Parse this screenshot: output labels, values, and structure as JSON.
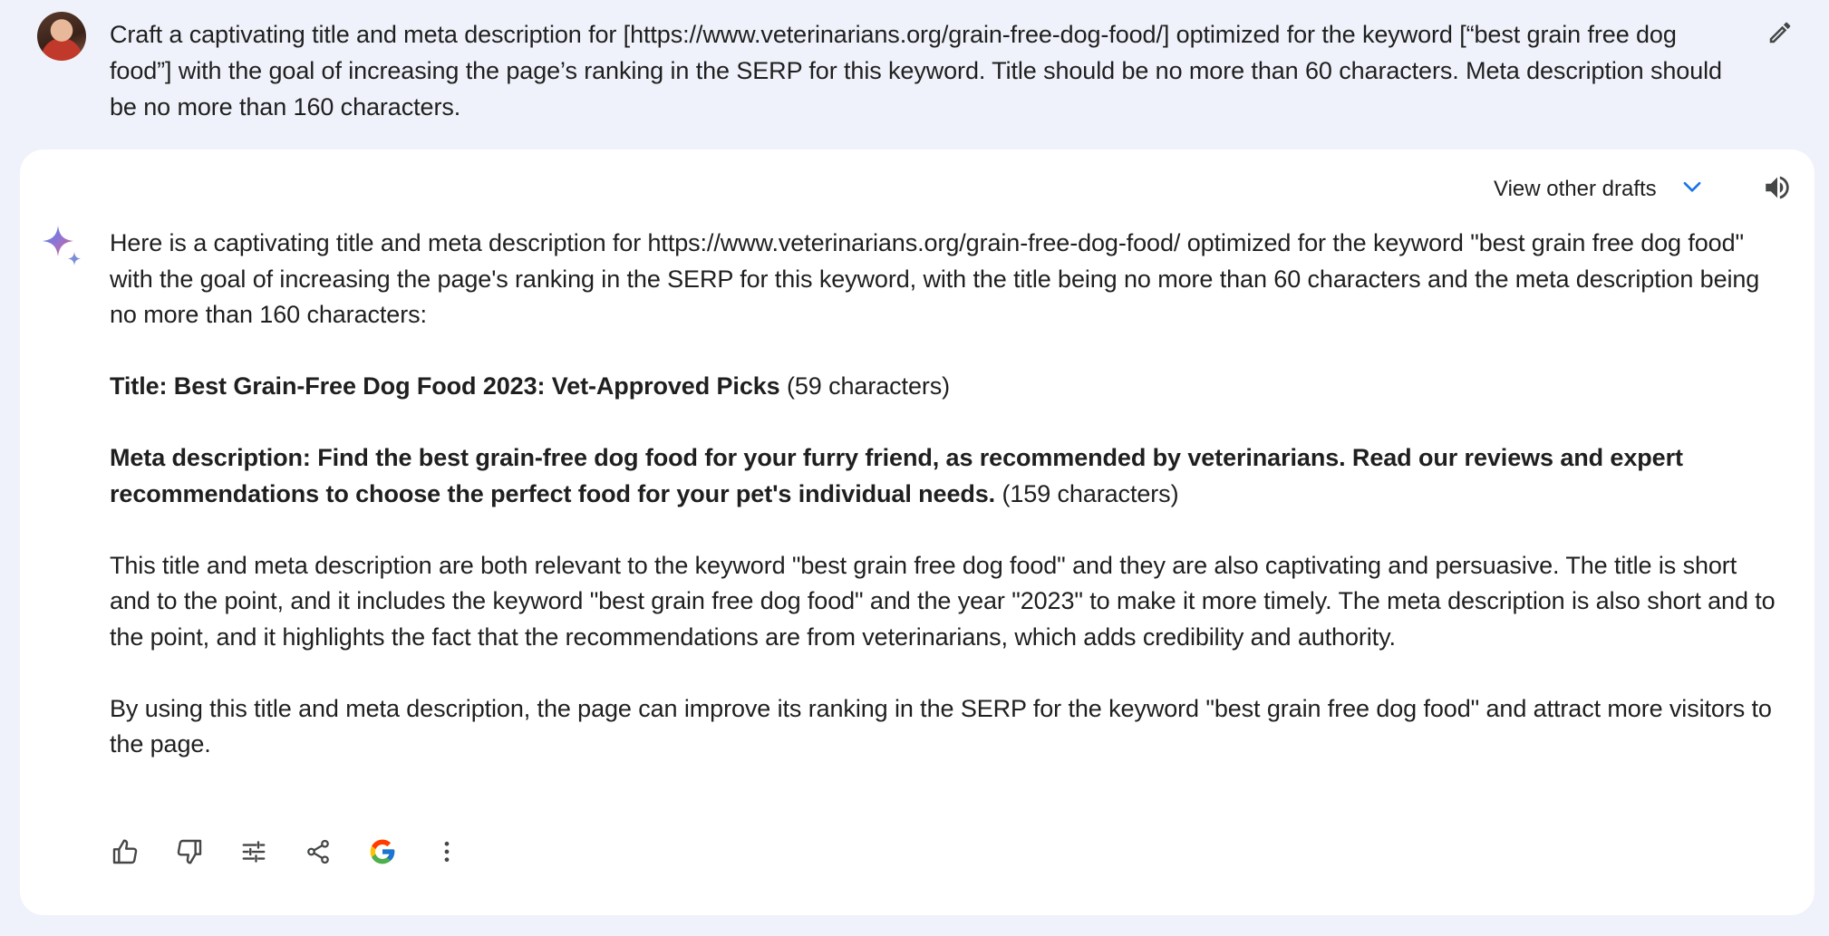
{
  "prompt": {
    "text": "Craft a captivating title and meta description for [https://www.veterinarians.org/grain-free-dog-food/] optimized for the keyword [“best grain free dog food”]  with the goal of increasing the page’s ranking in the SERP for this keyword. Title should be no more than 60 characters. Meta description should be no more than 160 characters.",
    "edit_icon": "pencil-icon"
  },
  "response": {
    "view_drafts_label": "View other drafts",
    "intro": "Here is a captivating title and meta description for https://www.veterinarians.org/grain-free-dog-food/ optimized for the keyword \"best grain free dog food\" with the goal of increasing the page's ranking in the SERP for this keyword, with the title being no more than 60 characters and the meta description being no more than 160 characters:",
    "title_bold": "Title: Best Grain-Free Dog Food 2023: Vet-Approved Picks",
    "title_count": " (59 characters)",
    "meta_bold": "Meta description: Find the best grain-free dog food for your furry friend, as recommended by veterinarians. Read our reviews and expert recommendations to choose the perfect food for your pet's individual needs.",
    "meta_count": " (159 characters)",
    "explanation": "This title and meta description are both relevant to the keyword \"best grain free dog food\" and they are also captivating and persuasive. The title is short and to the point, and it includes the keyword \"best grain free dog food\" and the year \"2023\" to make it more timely. The meta description is also short and to the point, and it highlights the fact that the recommendations are from veterinarians, which adds credibility and authority.",
    "conclusion": "By using this title and meta description, the page can improve its ranking in the SERP for the keyword \"best grain free dog food\" and attract more visitors to the page."
  },
  "actions": [
    "thumbs-up-icon",
    "thumbs-down-icon",
    "tune-icon",
    "share-icon",
    "google-icon",
    "more-vert-icon"
  ],
  "colors": {
    "page_background": "#eff2fa",
    "card_background": "#ffffff",
    "accent_blue": "#1a73e8",
    "text": "#1f1f1f",
    "icon": "#444746"
  }
}
